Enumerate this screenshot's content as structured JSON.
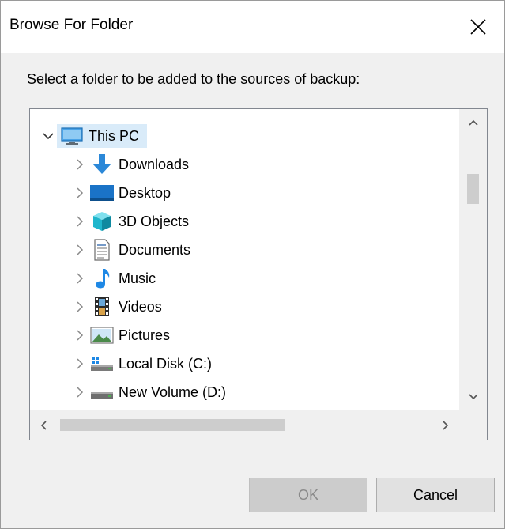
{
  "dialog": {
    "title": "Browse For Folder",
    "instruction": "Select a folder to be added to the sources of backup:",
    "close_icon": "close-icon"
  },
  "tree": {
    "root": {
      "label": "This PC",
      "icon": "computer-icon",
      "expanded": true,
      "selected": true
    },
    "items": [
      {
        "label": "Downloads",
        "icon": "downloads-icon"
      },
      {
        "label": "Desktop",
        "icon": "desktop-icon"
      },
      {
        "label": "3D Objects",
        "icon": "3d-objects-icon"
      },
      {
        "label": "Documents",
        "icon": "documents-icon"
      },
      {
        "label": "Music",
        "icon": "music-icon"
      },
      {
        "label": "Videos",
        "icon": "videos-icon"
      },
      {
        "label": "Pictures",
        "icon": "pictures-icon"
      },
      {
        "label": "Local Disk (C:)",
        "icon": "local-disk-icon"
      },
      {
        "label": "New Volume (D:)",
        "icon": "drive-icon"
      }
    ]
  },
  "buttons": {
    "ok_label": "OK",
    "ok_enabled": false,
    "cancel_label": "Cancel"
  },
  "colors": {
    "selection": "#d9ebf9",
    "dialog_bg": "#f0f0f0",
    "accent_blue": "#1e88e5"
  }
}
